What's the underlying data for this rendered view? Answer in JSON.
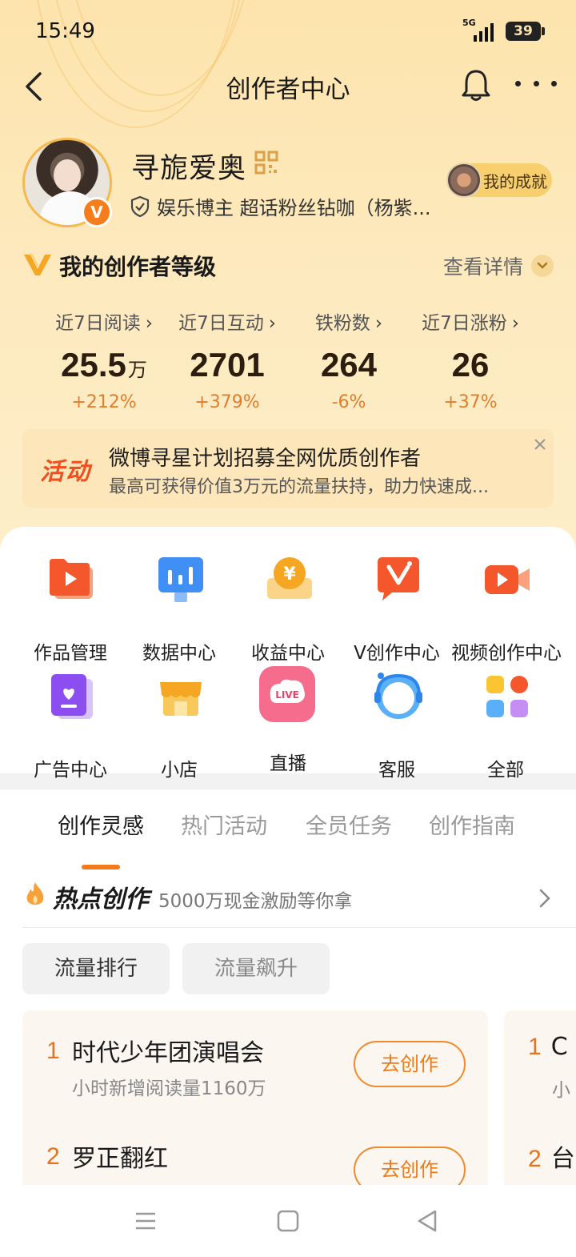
{
  "status_bar": {
    "time": "15:49",
    "network": "5G",
    "battery": "39"
  },
  "nav": {
    "title": "创作者中心"
  },
  "profile": {
    "name": "寻旎爱奥",
    "verify_text": "娱乐博主 超话粉丝钻咖（杨紫...",
    "achievement_label": "我的成就",
    "badge_letter": "V"
  },
  "level": {
    "title": "我的创作者等级",
    "detail_label": "查看详情"
  },
  "stats": [
    {
      "label": "近7日阅读",
      "value": "25.5",
      "unit": "万",
      "change": "+212%"
    },
    {
      "label": "近7日互动",
      "value": "2701",
      "unit": "",
      "change": "+379%"
    },
    {
      "label": "铁粉数",
      "value": "264",
      "unit": "",
      "change": "-6%"
    },
    {
      "label": "近7日涨粉",
      "value": "26",
      "unit": "",
      "change": "+37%"
    }
  ],
  "activity": {
    "badge": "活动",
    "title": "微博寻星计划招募全网优质创作者",
    "subtitle": "最高可获得价值3万元的流量扶持，助力快速成..."
  },
  "tools": [
    {
      "label": "作品管理",
      "icon": "folder-play-icon"
    },
    {
      "label": "数据中心",
      "icon": "data-chart-icon"
    },
    {
      "label": "收益中心",
      "icon": "yuan-coin-icon"
    },
    {
      "label": "V创作中心",
      "icon": "v-creation-icon"
    },
    {
      "label": "视频创作中心",
      "icon": "video-camera-icon"
    },
    {
      "label": "广告中心",
      "icon": "ad-heart-icon"
    },
    {
      "label": "小店",
      "icon": "shop-icon"
    },
    {
      "label": "直播",
      "icon": "live-icon"
    },
    {
      "label": "客服",
      "icon": "customer-service-icon"
    },
    {
      "label": "全部",
      "icon": "all-apps-icon"
    }
  ],
  "tabs": [
    "创作灵感",
    "热门活动",
    "全员任务",
    "创作指南"
  ],
  "hot": {
    "title": "热点创作",
    "subtitle": "5000万现金激励等你拿"
  },
  "filters": [
    "流量排行",
    "流量飙升"
  ],
  "ranking": [
    {
      "rank": "1",
      "title": "时代少年团演唱会",
      "subtitle": "小时新增阅读量1160万",
      "button": "去创作"
    },
    {
      "rank": "2",
      "title": "罗正翻红",
      "subtitle": "",
      "button": "去创作"
    }
  ],
  "ranking_peek": [
    {
      "rank": "1",
      "title": "C",
      "subtitle": "小"
    },
    {
      "rank": "2",
      "title": "台",
      "subtitle": ""
    }
  ],
  "colors": {
    "accent": "#f47a1a",
    "header_bg": "#fde4ad",
    "activity_bg": "#fde6b9"
  }
}
